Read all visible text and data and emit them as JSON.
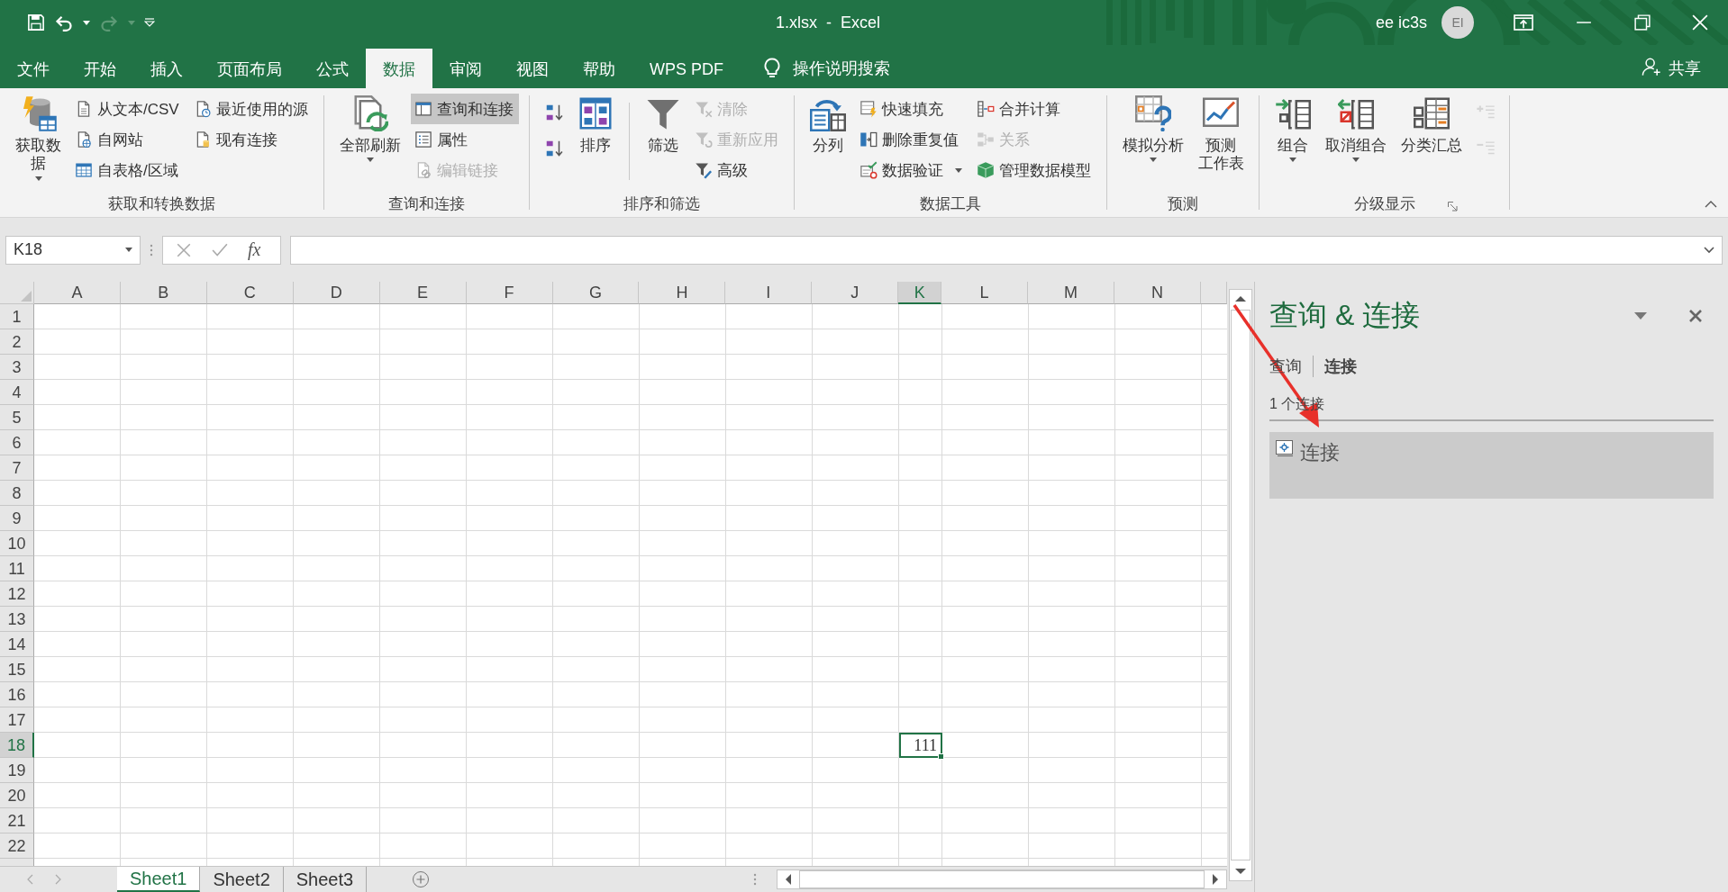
{
  "title_bar": {
    "title": "1.xlsx  -  Excel",
    "user": "ee ic3s",
    "avatar": "EI"
  },
  "menu_tabs": [
    {
      "label": "文件",
      "selected": false
    },
    {
      "label": "开始",
      "selected": false
    },
    {
      "label": "插入",
      "selected": false
    },
    {
      "label": "页面布局",
      "selected": false
    },
    {
      "label": "公式",
      "selected": false
    },
    {
      "label": "数据",
      "selected": true
    },
    {
      "label": "审阅",
      "selected": false
    },
    {
      "label": "视图",
      "selected": false
    },
    {
      "label": "帮助",
      "selected": false
    },
    {
      "label": "WPS PDF",
      "selected": false
    }
  ],
  "tell_me": "操作说明搜索",
  "share": "共享",
  "ribbon_groups": [
    {
      "label": "获取和转换数据",
      "launcher": false,
      "controls": [
        {
          "kind": "large",
          "lines": [
            "获取数",
            "据"
          ],
          "dropdown": true
        },
        {
          "kind": "stack",
          "items": [
            {
              "label": "从文本/CSV",
              "disabled": false
            },
            {
              "label": "自网站",
              "disabled": false
            },
            {
              "label": "自表格/区域",
              "disabled": false
            }
          ]
        },
        {
          "kind": "stack",
          "items": [
            {
              "label": "最近使用的源",
              "disabled": false
            },
            {
              "label": "现有连接",
              "disabled": false
            }
          ]
        }
      ]
    },
    {
      "label": "查询和连接",
      "launcher": false,
      "controls": [
        {
          "kind": "large",
          "label": "全部刷新",
          "dropdown": true
        },
        {
          "kind": "stack",
          "items": [
            {
              "label": "查询和连接",
              "disabled": false,
              "on": true
            },
            {
              "label": "属性",
              "disabled": false,
              "on": false
            },
            {
              "label": "编辑链接",
              "disabled": true,
              "on": false
            }
          ]
        }
      ]
    },
    {
      "label": "排序和筛选",
      "launcher": false,
      "controls": [
        {
          "kind": "icon_stack",
          "items": [
            {
              "disabled": false
            },
            {
              "disabled": false
            }
          ]
        },
        {
          "kind": "large",
          "label": "排序",
          "dropdown": false
        },
        {
          "kind": "separator"
        },
        {
          "kind": "large",
          "label": "筛选",
          "dropdown": false
        },
        {
          "kind": "stack",
          "items": [
            {
              "label": "清除",
              "disabled": true
            },
            {
              "label": "重新应用",
              "disabled": true
            },
            {
              "label": "高级",
              "disabled": false
            }
          ]
        }
      ]
    },
    {
      "label": "数据工具",
      "launcher": false,
      "controls": [
        {
          "kind": "large",
          "label": "分列",
          "dropdown": false
        },
        {
          "kind": "stack",
          "items": [
            {
              "label": "快速填充",
              "disabled": false,
              "dropdown": false
            },
            {
              "label": "删除重复值",
              "disabled": false,
              "dropdown": false
            },
            {
              "label": "数据验证",
              "disabled": false,
              "dropdown": true
            }
          ]
        },
        {
          "kind": "stack",
          "items": [
            {
              "label": "合并计算",
              "disabled": false
            },
            {
              "label": "关系",
              "disabled": true
            },
            {
              "label": "管理数据模型",
              "disabled": false
            }
          ]
        }
      ]
    },
    {
      "label": "预测",
      "launcher": false,
      "controls": [
        {
          "kind": "large",
          "label": "模拟分析",
          "dropdown": true
        },
        {
          "kind": "large",
          "lines": [
            "预测",
            "工作表"
          ],
          "dropdown": false
        }
      ]
    },
    {
      "label": "分级显示",
      "launcher": true,
      "controls": [
        {
          "kind": "large",
          "label": "组合",
          "dropdown": true
        },
        {
          "kind": "large",
          "label": "取消组合",
          "dropdown": true
        },
        {
          "kind": "large",
          "label": "分类汇总",
          "dropdown": false
        },
        {
          "kind": "icon_stack",
          "items": [
            {
              "disabled": true
            },
            {
              "disabled": true
            }
          ]
        }
      ]
    }
  ],
  "formula_bar": {
    "name_box": "K18",
    "function_label": "fx"
  },
  "columns": [
    {
      "label": "A",
      "selected": false
    },
    {
      "label": "B",
      "selected": false
    },
    {
      "label": "C",
      "selected": false
    },
    {
      "label": "D",
      "selected": false
    },
    {
      "label": "E",
      "selected": false
    },
    {
      "label": "F",
      "selected": false
    },
    {
      "label": "G",
      "selected": false
    },
    {
      "label": "H",
      "selected": false
    },
    {
      "label": "I",
      "selected": false
    },
    {
      "label": "J",
      "selected": false
    },
    {
      "label": "K",
      "selected": true
    },
    {
      "label": "L",
      "selected": false
    },
    {
      "label": "M",
      "selected": false
    },
    {
      "label": "N",
      "selected": false
    }
  ],
  "rows": [
    {
      "label": "1",
      "selected": false
    },
    {
      "label": "2",
      "selected": false
    },
    {
      "label": "3",
      "selected": false
    },
    {
      "label": "4",
      "selected": false
    },
    {
      "label": "5",
      "selected": false
    },
    {
      "label": "6",
      "selected": false
    },
    {
      "label": "7",
      "selected": false
    },
    {
      "label": "8",
      "selected": false
    },
    {
      "label": "9",
      "selected": false
    },
    {
      "label": "10",
      "selected": false
    },
    {
      "label": "11",
      "selected": false
    },
    {
      "label": "12",
      "selected": false
    },
    {
      "label": "13",
      "selected": false
    },
    {
      "label": "14",
      "selected": false
    },
    {
      "label": "15",
      "selected": false
    },
    {
      "label": "16",
      "selected": false
    },
    {
      "label": "17",
      "selected": false
    },
    {
      "label": "18",
      "selected": true,
      "cells": [
        null,
        null,
        null,
        null,
        null,
        null,
        null,
        null,
        null,
        null,
        {
          "value": "111",
          "selected": true
        }
      ]
    },
    {
      "label": "19",
      "selected": false
    },
    {
      "label": "20",
      "selected": false
    },
    {
      "label": "21",
      "selected": false
    },
    {
      "label": "22",
      "selected": false
    }
  ],
  "sheet_tabs": [
    {
      "label": "Sheet1",
      "selected": true
    },
    {
      "label": "Sheet2",
      "selected": false
    },
    {
      "label": "Sheet3",
      "selected": false
    }
  ],
  "side_panel": {
    "title": "查询 & 连接",
    "tabs": [
      {
        "label": "查询",
        "selected": false
      },
      {
        "label": "连接",
        "selected": true
      }
    ],
    "count": "1 个连接",
    "items": [
      {
        "label": "连接",
        "selected": true
      }
    ]
  }
}
